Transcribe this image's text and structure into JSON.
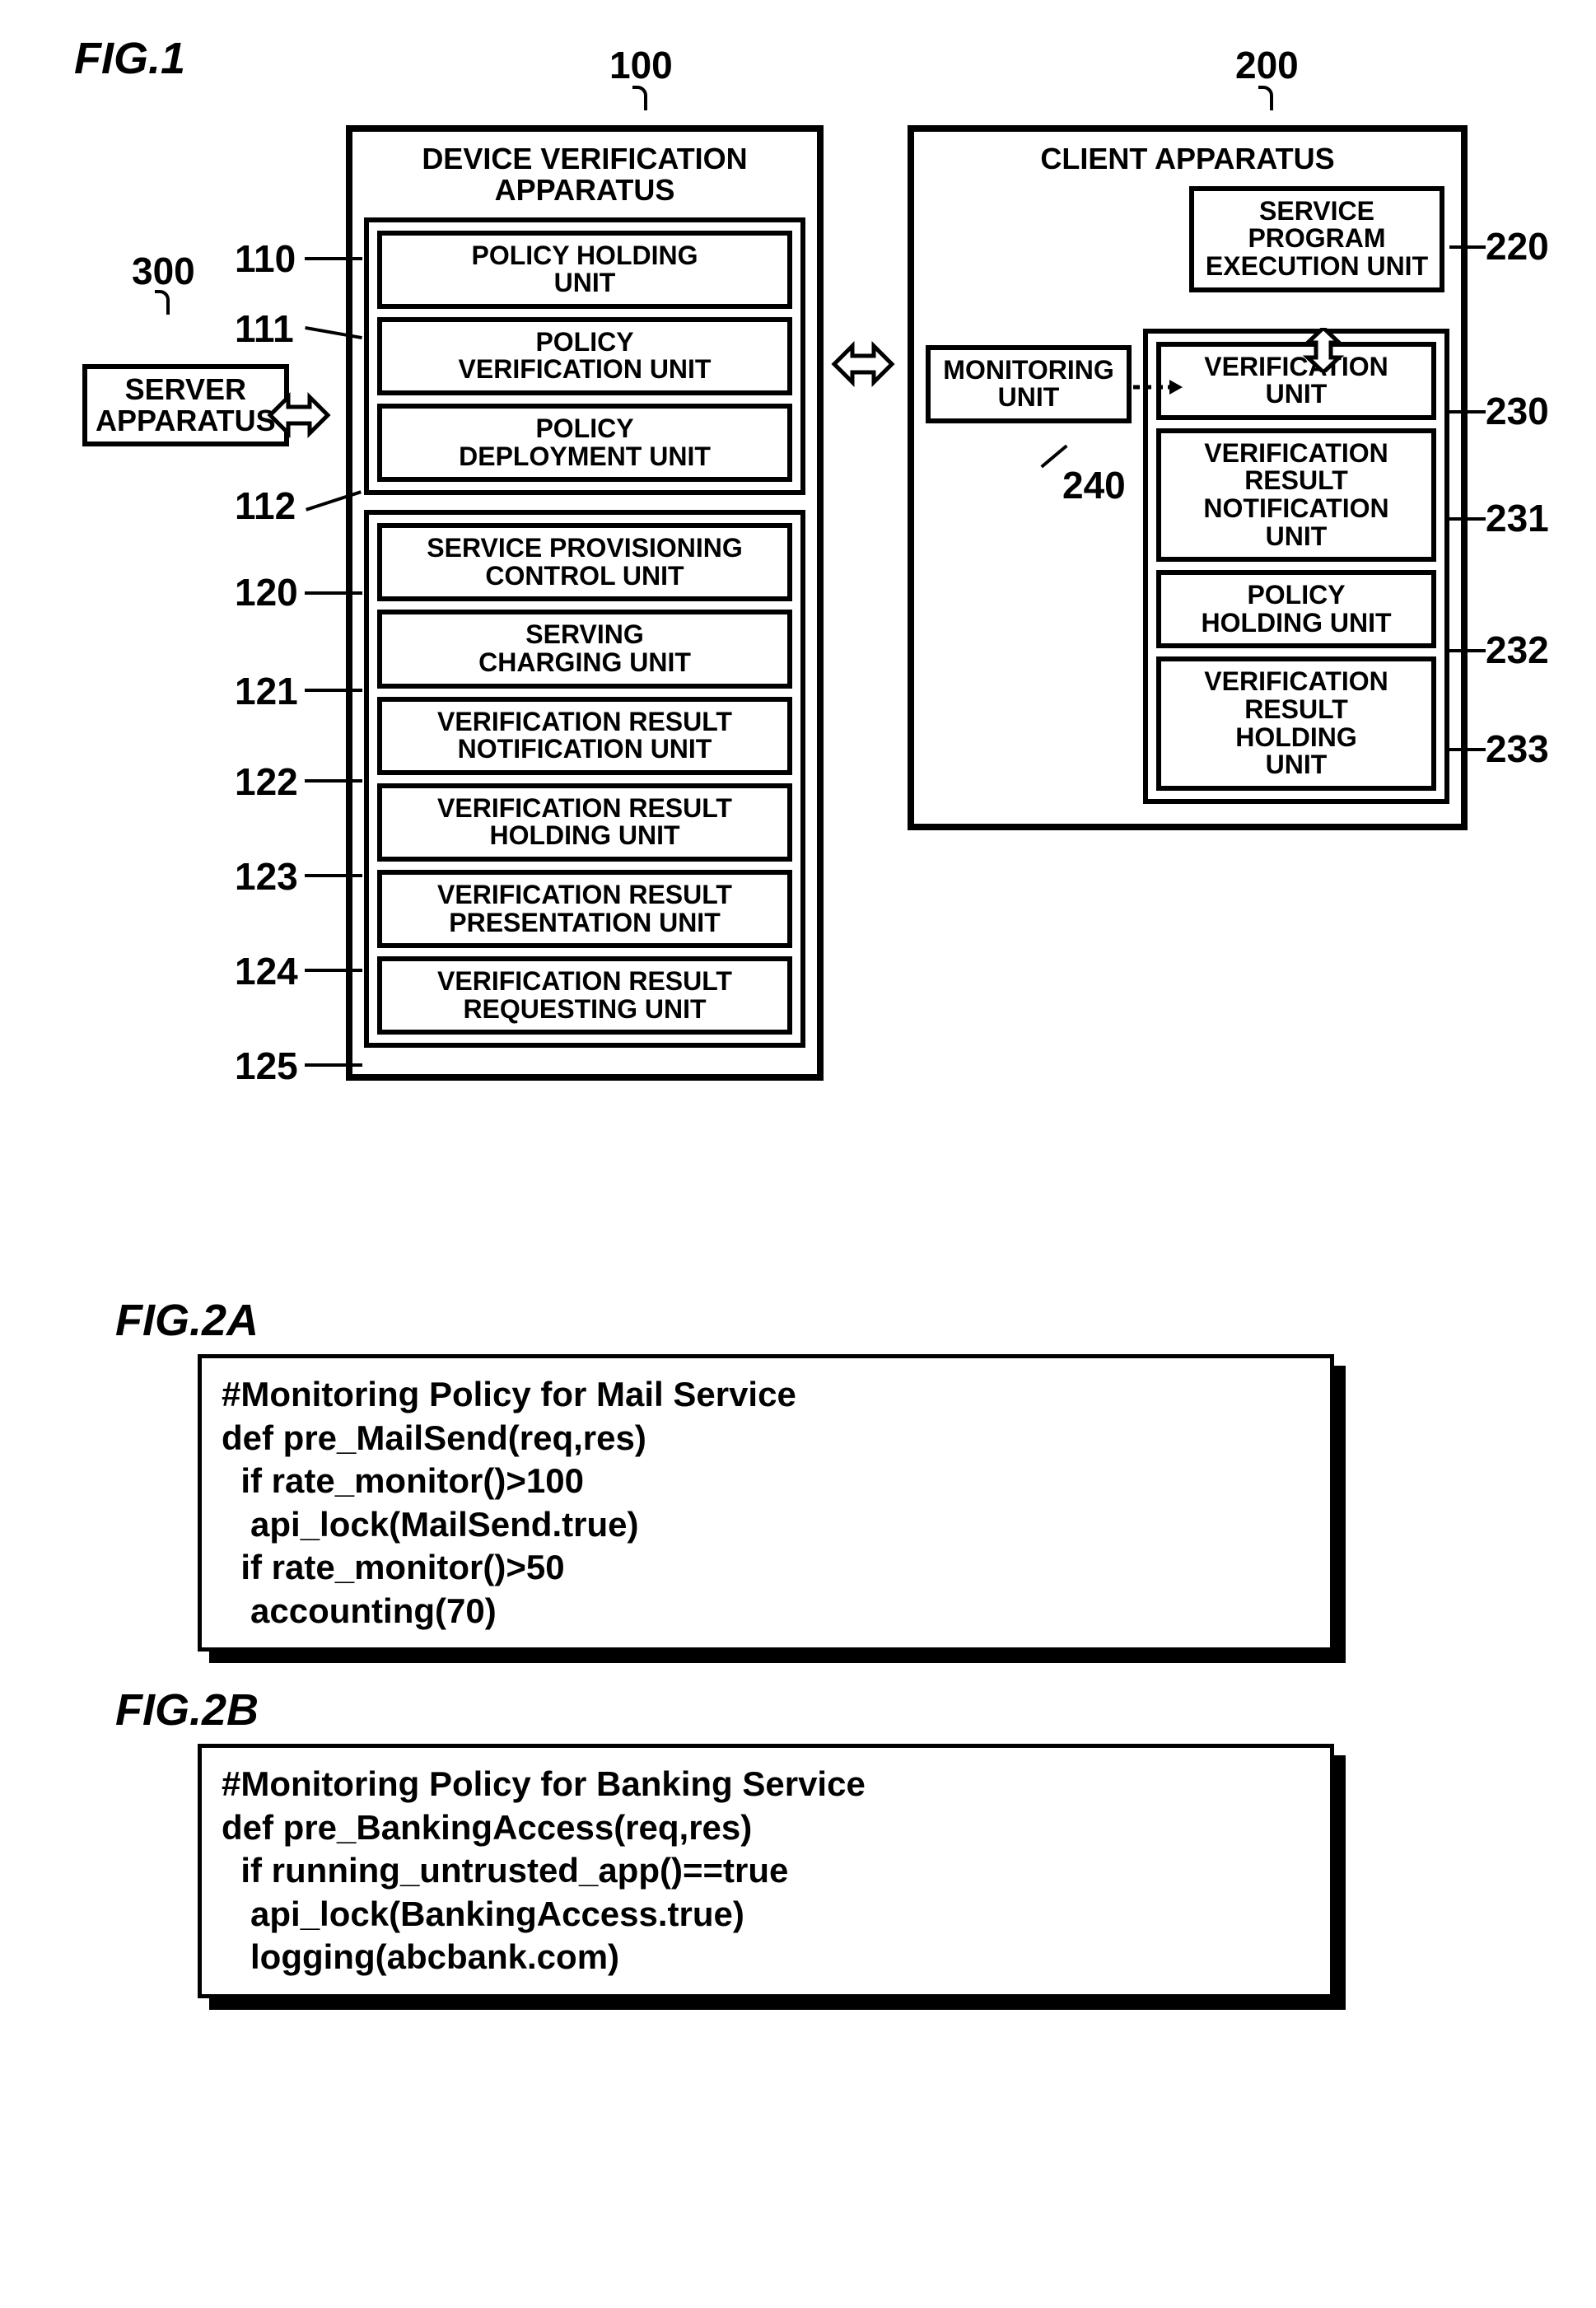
{
  "fig1": {
    "label": "FIG.1",
    "refs": {
      "r100": "100",
      "r200": "200",
      "r300": "300",
      "r110": "110",
      "r111": "111",
      "r112": "112",
      "r120": "120",
      "r121": "121",
      "r122": "122",
      "r123": "123",
      "r124": "124",
      "r125": "125",
      "r220": "220",
      "r230": "230",
      "r231": "231",
      "r232": "232",
      "r233": "233",
      "r240": "240"
    },
    "server": "SERVER\nAPPARATUS",
    "device_apparatus": {
      "title": "DEVICE VERIFICATION\nAPPARATUS",
      "group1": {
        "policy_holding": "POLICY HOLDING\nUNIT",
        "policy_verification": "POLICY\nVERIFICATION UNIT",
        "policy_deployment": "POLICY\nDEPLOYMENT UNIT"
      },
      "group2": {
        "service_provisioning": "SERVICE PROVISIONING\nCONTROL UNIT",
        "serving_charging": "SERVING\nCHARGING UNIT",
        "verif_result_notif": "VERIFICATION RESULT\nNOTIFICATION UNIT",
        "verif_result_hold": "VERIFICATION RESULT\nHOLDING UNIT",
        "verif_result_present": "VERIFICATION RESULT\nPRESENTATION UNIT",
        "verif_result_request": "VERIFICATION RESULT\nREQUESTING UNIT"
      }
    },
    "client_apparatus": {
      "title": "CLIENT APPARATUS",
      "service_program_exec": "SERVICE\nPROGRAM\nEXECUTION UNIT",
      "monitoring": "MONITORING\nUNIT",
      "group": {
        "verification_unit": "VERIFICATION\nUNIT",
        "verif_result_notif": "VERIFICATION\nRESULT\nNOTIFICATION\nUNIT",
        "policy_holding": "POLICY\nHOLDING UNIT",
        "verif_result_hold": "VERIFICATION\nRESULT\nHOLDING\nUNIT"
      }
    }
  },
  "fig2a": {
    "label": "FIG.2A",
    "code": "#Monitoring Policy for Mail Service\ndef pre_MailSend(req,res)\n  if rate_monitor()>100\n   api_lock(MailSend.true)\n  if rate_monitor()>50\n   accounting(70)"
  },
  "fig2b": {
    "label": "FIG.2B",
    "code": "#Monitoring Policy for Banking Service\ndef pre_BankingAccess(req,res)\n  if running_untrusted_app()==true\n   api_lock(BankingAccess.true)\n   logging(abcbank.com)"
  }
}
